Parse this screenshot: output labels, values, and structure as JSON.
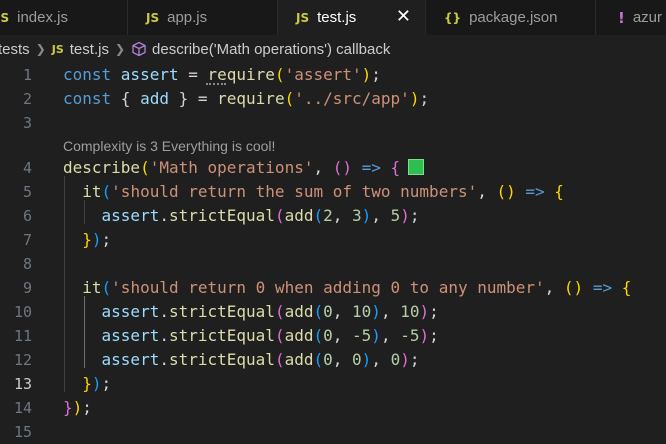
{
  "tabs": [
    {
      "icon": "JS",
      "label": "index.js",
      "active": false
    },
    {
      "icon": "JS",
      "label": "app.js",
      "active": false
    },
    {
      "icon": "JS",
      "label": "test.js",
      "active": true
    },
    {
      "icon": "{}",
      "label": "package.json",
      "active": false
    },
    {
      "icon": "!",
      "label": "azur",
      "active": false
    }
  ],
  "close_glyph": "✕",
  "breadcrumb": {
    "folder": "tests",
    "file_icon": "JS",
    "file": "test.js",
    "symbol": "describe('Math operations') callback"
  },
  "codelens": "Complexity is 3 Everything is cool!",
  "lines": [
    {
      "n": "1",
      "tokens": [
        [
          "k",
          "const "
        ],
        [
          "v",
          "assert"
        ],
        [
          "p",
          " = "
        ],
        [
          "f",
          "require"
        ],
        [
          "b1",
          "("
        ],
        [
          "s",
          "'assert'"
        ],
        [
          "b1",
          ")"
        ],
        [
          "p",
          ";"
        ]
      ]
    },
    {
      "n": "2",
      "tokens": [
        [
          "k",
          "const "
        ],
        [
          "p",
          "{ "
        ],
        [
          "v",
          "add"
        ],
        [
          "p",
          " } = "
        ],
        [
          "f",
          "require"
        ],
        [
          "b1",
          "("
        ],
        [
          "s",
          "'../src/app'"
        ],
        [
          "b1",
          ")"
        ],
        [
          "p",
          ";"
        ]
      ]
    },
    {
      "n": "3",
      "tokens": []
    },
    {
      "n": "4",
      "tokens": [
        [
          "f",
          "describe"
        ],
        [
          "b1",
          "("
        ],
        [
          "s",
          "'Math operations'"
        ],
        [
          "p",
          ", "
        ],
        [
          "b2",
          "()"
        ],
        [
          "k",
          " => "
        ],
        [
          "b2",
          "{"
        ]
      ]
    },
    {
      "n": "5",
      "tokens": [
        [
          "p",
          "  "
        ],
        [
          "f",
          "it"
        ],
        [
          "b3",
          "("
        ],
        [
          "s",
          "'should return the sum of two numbers'"
        ],
        [
          "p",
          ", "
        ],
        [
          "b1",
          "()"
        ],
        [
          "k",
          " => "
        ],
        [
          "b1",
          "{"
        ]
      ]
    },
    {
      "n": "6",
      "tokens": [
        [
          "p",
          "    "
        ],
        [
          "v",
          "assert"
        ],
        [
          "p",
          "."
        ],
        [
          "f",
          "strictEqual"
        ],
        [
          "b2",
          "("
        ],
        [
          "f",
          "add"
        ],
        [
          "b3",
          "("
        ],
        [
          "n",
          "2"
        ],
        [
          "p",
          ", "
        ],
        [
          "n",
          "3"
        ],
        [
          "b3",
          ")"
        ],
        [
          "p",
          ", "
        ],
        [
          "n",
          "5"
        ],
        [
          "b2",
          ")"
        ],
        [
          "p",
          ";"
        ]
      ]
    },
    {
      "n": "7",
      "tokens": [
        [
          "p",
          "  "
        ],
        [
          "b1",
          "}"
        ],
        [
          "b3",
          ")"
        ],
        [
          "p",
          ";"
        ]
      ]
    },
    {
      "n": "8",
      "tokens": []
    },
    {
      "n": "9",
      "tokens": [
        [
          "p",
          "  "
        ],
        [
          "f",
          "it"
        ],
        [
          "b3",
          "("
        ],
        [
          "s",
          "'should return 0 when adding 0 to any number'"
        ],
        [
          "p",
          ", "
        ],
        [
          "b1",
          "()"
        ],
        [
          "k",
          " => "
        ],
        [
          "b1",
          "{"
        ]
      ]
    },
    {
      "n": "10",
      "tokens": [
        [
          "p",
          "    "
        ],
        [
          "v",
          "assert"
        ],
        [
          "p",
          "."
        ],
        [
          "f",
          "strictEqual"
        ],
        [
          "b2",
          "("
        ],
        [
          "f",
          "add"
        ],
        [
          "b3",
          "("
        ],
        [
          "n",
          "0"
        ],
        [
          "p",
          ", "
        ],
        [
          "n",
          "10"
        ],
        [
          "b3",
          ")"
        ],
        [
          "p",
          ", "
        ],
        [
          "n",
          "10"
        ],
        [
          "b2",
          ")"
        ],
        [
          "p",
          ";"
        ]
      ]
    },
    {
      "n": "11",
      "tokens": [
        [
          "p",
          "    "
        ],
        [
          "v",
          "assert"
        ],
        [
          "p",
          "."
        ],
        [
          "f",
          "strictEqual"
        ],
        [
          "b2",
          "("
        ],
        [
          "f",
          "add"
        ],
        [
          "b3",
          "("
        ],
        [
          "n",
          "0"
        ],
        [
          "p",
          ", "
        ],
        [
          "n",
          "-5"
        ],
        [
          "b3",
          ")"
        ],
        [
          "p",
          ", "
        ],
        [
          "n",
          "-5"
        ],
        [
          "b2",
          ")"
        ],
        [
          "p",
          ";"
        ]
      ]
    },
    {
      "n": "12",
      "tokens": [
        [
          "p",
          "    "
        ],
        [
          "v",
          "assert"
        ],
        [
          "p",
          "."
        ],
        [
          "f",
          "strictEqual"
        ],
        [
          "b2",
          "("
        ],
        [
          "f",
          "add"
        ],
        [
          "b3",
          "("
        ],
        [
          "n",
          "0"
        ],
        [
          "p",
          ", "
        ],
        [
          "n",
          "0"
        ],
        [
          "b3",
          ")"
        ],
        [
          "p",
          ", "
        ],
        [
          "n",
          "0"
        ],
        [
          "b2",
          ")"
        ],
        [
          "p",
          ";"
        ]
      ]
    },
    {
      "n": "13",
      "tokens": [
        [
          "p",
          "  "
        ],
        [
          "b1",
          "}"
        ],
        [
          "b3",
          ")"
        ],
        [
          "p",
          ";"
        ]
      ],
      "current": true
    },
    {
      "n": "14",
      "tokens": [
        [
          "b2",
          "}"
        ],
        [
          "b1",
          ")"
        ],
        [
          "p",
          ";"
        ]
      ]
    },
    {
      "n": "15",
      "tokens": []
    }
  ],
  "colors": {
    "background": "#1f1f1f",
    "tab_bar": "#181818",
    "keyword": "#569cd6",
    "string": "#ce9178",
    "function": "#dcdcaa",
    "number": "#b5cea8"
  }
}
